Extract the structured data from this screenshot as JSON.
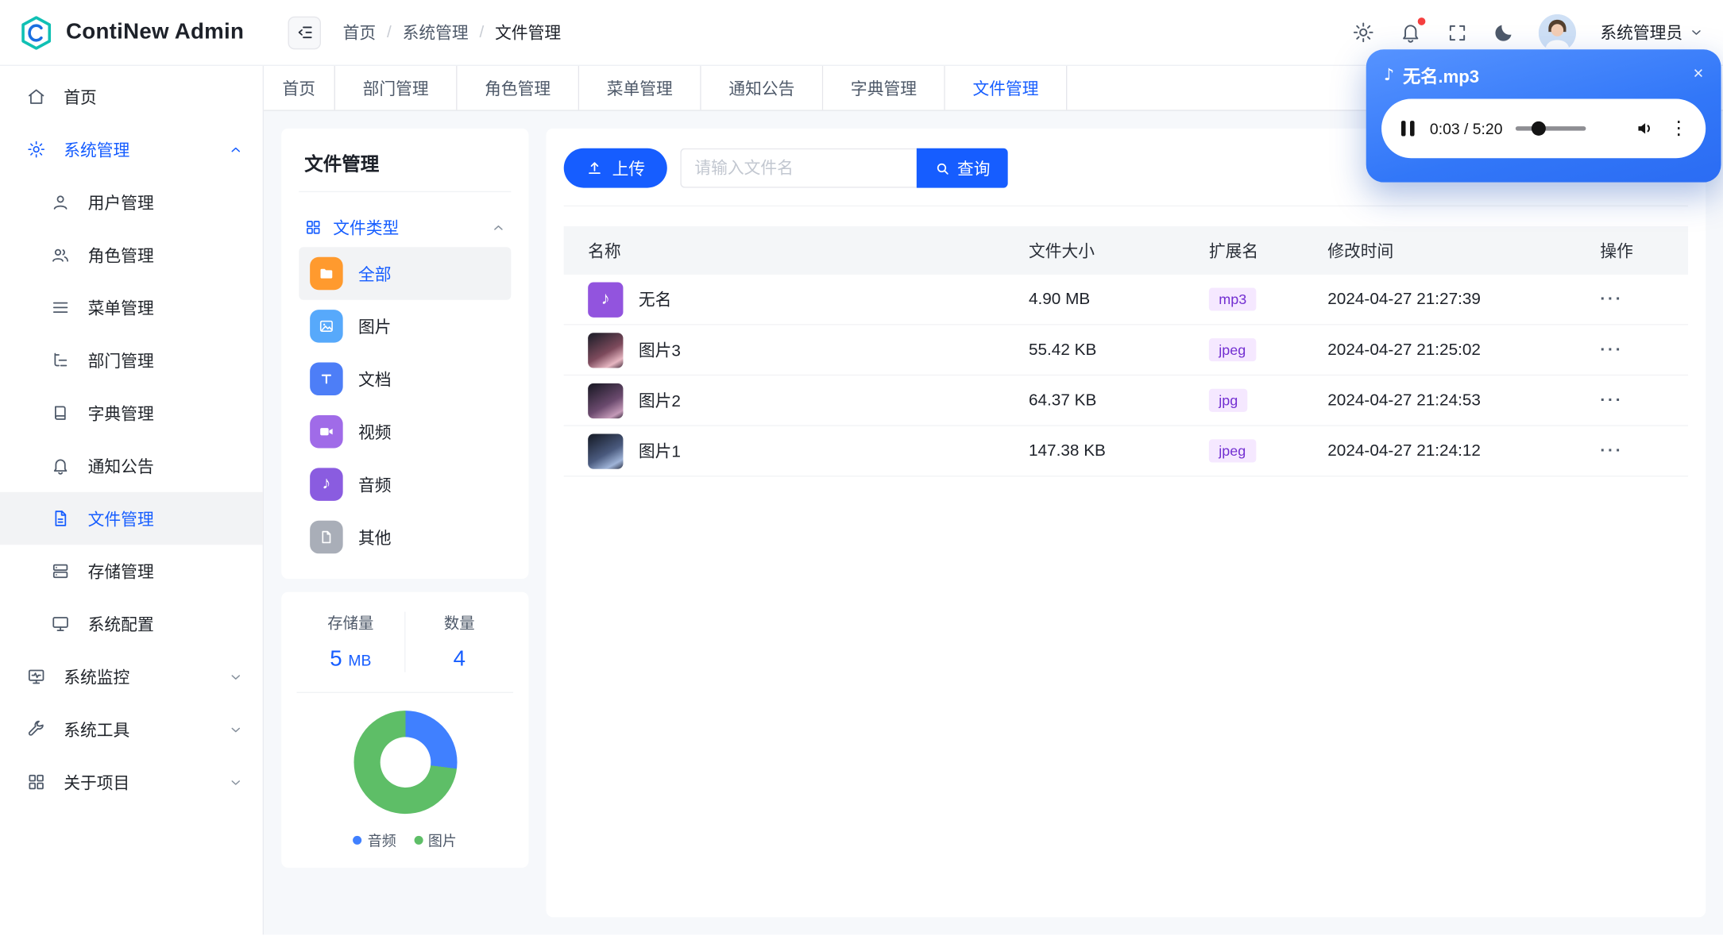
{
  "app": {
    "title": "ContiNew Admin"
  },
  "topbar": {
    "breadcrumb": [
      "首页",
      "系统管理",
      "文件管理"
    ],
    "separator": "/",
    "username": "系统管理员"
  },
  "tabs": [
    "首页",
    "部门管理",
    "角色管理",
    "菜单管理",
    "通知公告",
    "字典管理",
    "文件管理"
  ],
  "active_tab": "文件管理",
  "sidebar": {
    "home": "首页",
    "system": "系统管理",
    "system_children": [
      "用户管理",
      "角色管理",
      "菜单管理",
      "部门管理",
      "字典管理",
      "通知公告",
      "文件管理",
      "存储管理",
      "系统配置"
    ],
    "active_item": "文件管理",
    "monitor": "系统监控",
    "tools": "系统工具",
    "about": "关于项目"
  },
  "panel": {
    "title": "文件管理",
    "group": "文件类型",
    "types": [
      "全部",
      "图片",
      "文档",
      "视频",
      "音频",
      "其他"
    ],
    "active_type": "全部",
    "stats": {
      "storage_label": "存储量",
      "storage_value": "5",
      "storage_unit": "MB",
      "count_label": "数量",
      "count_value": "4"
    },
    "legend": [
      {
        "label": "音频",
        "color": "#4080FF"
      },
      {
        "label": "图片",
        "color": "#5EBE67"
      }
    ]
  },
  "chart_data": {
    "type": "pie",
    "categories": [
      "音频",
      "图片"
    ],
    "values": [
      1,
      3
    ],
    "colors": [
      "#4080FF",
      "#5EBE67"
    ],
    "title": "",
    "legend_position": "bottom"
  },
  "toolbar": {
    "upload_label": "上传",
    "search_placeholder": "请输入文件名",
    "query_label": "查询"
  },
  "table": {
    "columns": [
      "名称",
      "文件大小",
      "扩展名",
      "修改时间",
      "操作"
    ],
    "rows": [
      {
        "name": "无名",
        "size": "4.90 MB",
        "ext": "mp3",
        "time": "2024-04-27 21:27:39"
      },
      {
        "name": "图片3",
        "size": "55.42 KB",
        "ext": "jpeg",
        "time": "2024-04-27 21:25:02"
      },
      {
        "name": "图片2",
        "size": "64.37 KB",
        "ext": "jpg",
        "time": "2024-04-27 21:24:53"
      },
      {
        "name": "图片1",
        "size": "147.38 KB",
        "ext": "jpeg",
        "time": "2024-04-27 21:24:12"
      }
    ],
    "actions_glyph": "···"
  },
  "player": {
    "title": "无名.mp3",
    "time": "0:03 / 5:20",
    "close": "×"
  },
  "colors": {
    "primary": "#165DFF",
    "tag_bg": "#F5E8FF",
    "tag_text": "#722ED1",
    "notification_dot": "#F53F3F"
  }
}
